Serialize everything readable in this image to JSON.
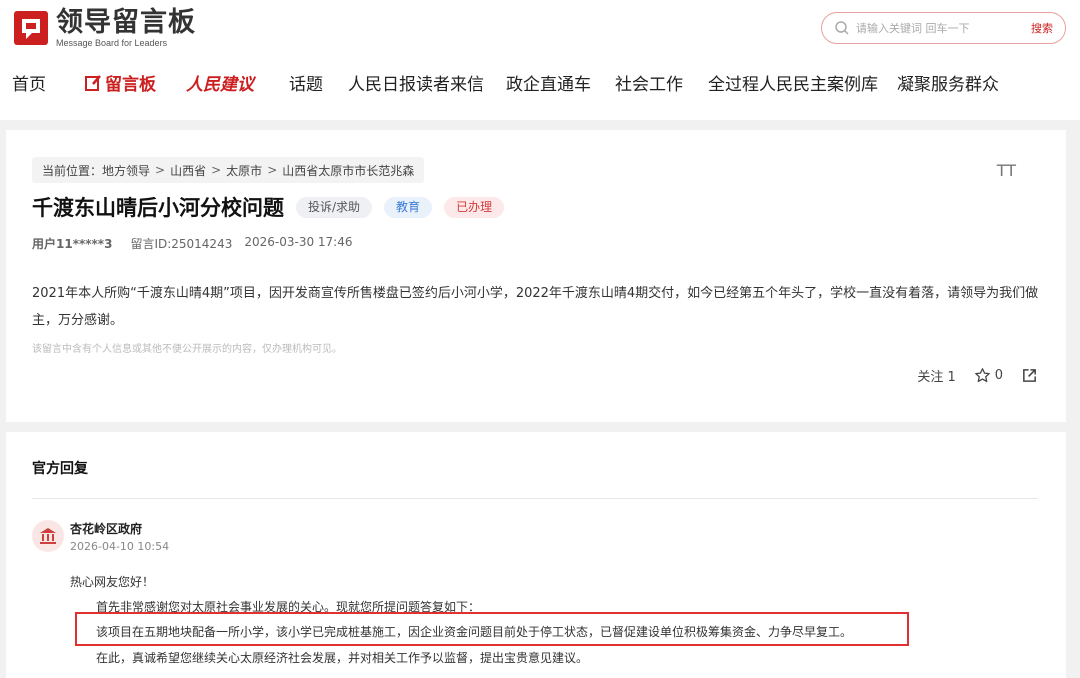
{
  "header": {
    "logo_title": "领导留言板",
    "logo_sub": "Message Board for Leaders",
    "brand_color": "#cc1f1f",
    "search": {
      "placeholder": "请输入关键词 回车一下",
      "button": "搜索"
    }
  },
  "nav": {
    "items": [
      "首页",
      "留言板",
      "人民建议",
      "话题",
      "人民日报读者来信",
      "政企直通车",
      "社会工作",
      "全过程人民民主案例库",
      "凝聚服务群众"
    ]
  },
  "post": {
    "breadcrumb": {
      "prefix": "当前位置：",
      "items": [
        "地方领导",
        "山西省",
        "太原市",
        "山西省太原市市长范兆森"
      ]
    },
    "font_toggle": "TT",
    "title": "千渡东山晴后小河分校问题",
    "tags": [
      "投诉/求助",
      "教育",
      "已办理"
    ],
    "user": "用户11*****3",
    "message_id": "留言ID:25014243",
    "datetime": "2026-03-30 17:46",
    "body": "2021年本人所购“千渡东山晴4期”项目，因开发商宣传所售楼盘已签约后小河小学，2022年千渡东山晴4期交付，如今已经第五个年头了，学校一直没有着落，请领导为我们做主，万分感谢。",
    "notice": "该留言中含有个人信息或其他不便公开展示的内容，仅办理机构可见。",
    "actions": {
      "follow": "关注 1",
      "star_count": "0"
    }
  },
  "reply": {
    "heading": "官方回复",
    "org": "杏花岭区政府",
    "date": "2026-04-10 10:54",
    "lines": [
      "热心网友您好！",
      "首先非常感谢您对太原社会事业发展的关心。现就您所提问题答复如下：",
      "该项目在五期地块配备一所小学，该小学已完成桩基施工，因企业资金问题目前处于停工状态，已督促建设单位积极筹集资金、力争尽早复工。",
      "在此，真诚希望您继续关心太原经济社会发展，并对相关工作予以监督，提出宝贵意见建议。"
    ]
  }
}
